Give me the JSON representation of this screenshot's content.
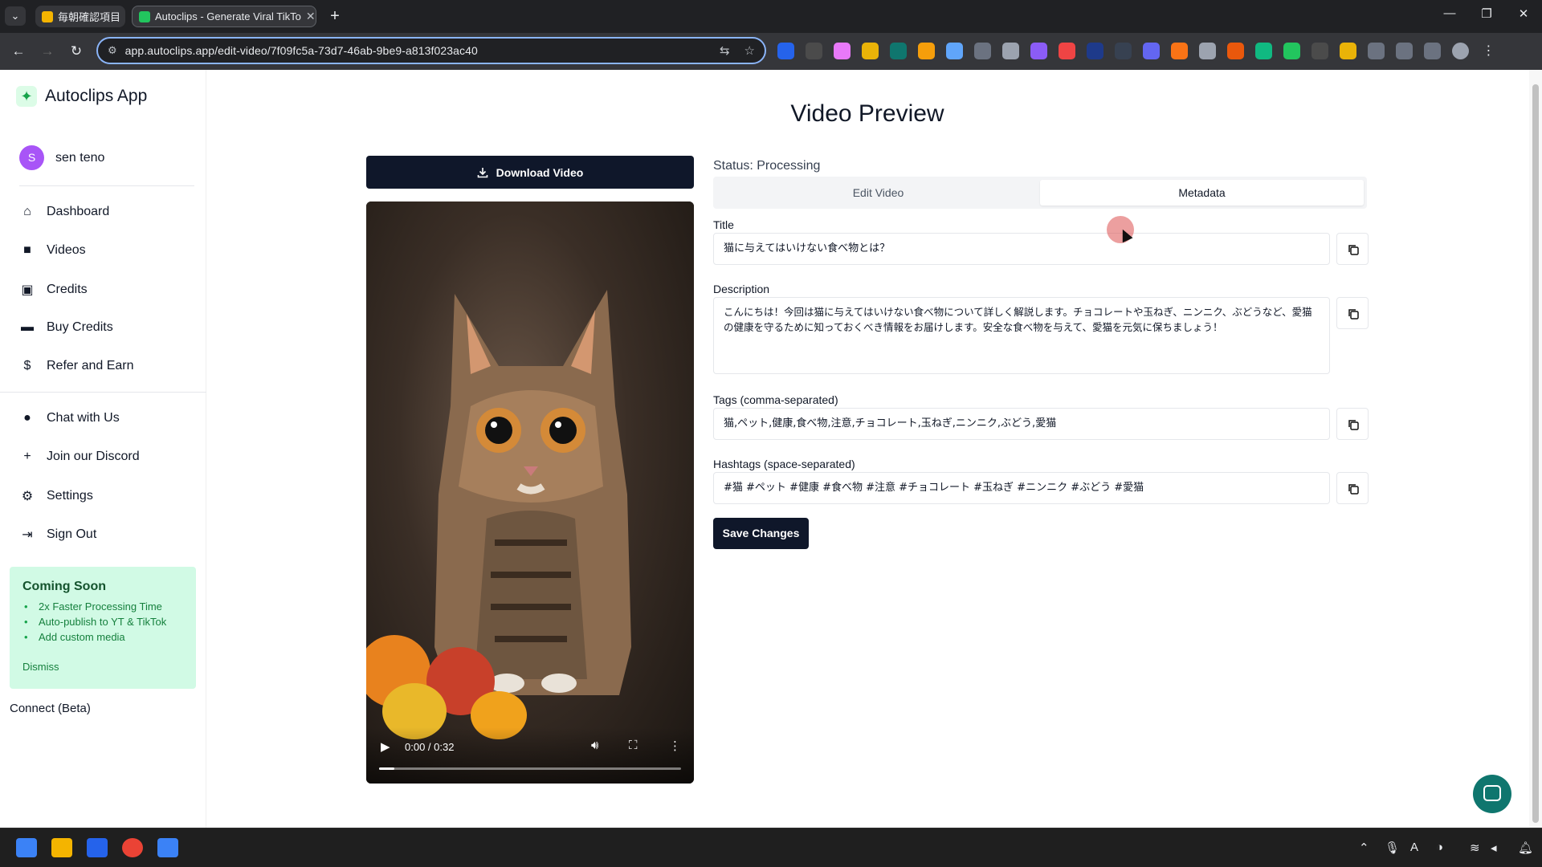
{
  "browser": {
    "tabs": [
      {
        "label": "毎朝確認項目"
      },
      {
        "label": "Autoclips - Generate Viral TikTo"
      }
    ],
    "url": "app.autoclips.app/edit-video/7f09fc5a-73d7-46ab-9be9-a813f023ac40"
  },
  "sidebar": {
    "brand": "Autoclips App",
    "user": {
      "initial": "S",
      "name": "sen teno"
    },
    "nav": [
      {
        "label": "Dashboard",
        "icon": "home-icon"
      },
      {
        "label": "Videos",
        "icon": "video-camera-icon"
      },
      {
        "label": "Credits",
        "icon": "receipt-icon"
      },
      {
        "label": "Buy Credits",
        "icon": "credit-card-icon"
      },
      {
        "label": "Refer and Earn",
        "icon": "dollar-circle-icon"
      }
    ],
    "nav2": [
      {
        "label": "Chat with Us",
        "icon": "chat-bubble-icon"
      },
      {
        "label": "Join our Discord",
        "icon": "plus-icon"
      },
      {
        "label": "Settings",
        "icon": "gear-icon"
      },
      {
        "label": "Sign Out",
        "icon": "sign-out-icon"
      }
    ],
    "coming_soon": {
      "title": "Coming Soon",
      "items": [
        "2x Faster Processing Time",
        "Auto-publish to YT & TikTok",
        "Add custom media"
      ],
      "dismiss": "Dismiss"
    },
    "connect": "Connect (Beta)"
  },
  "main": {
    "title": "Video Preview",
    "download_label": "Download Video",
    "video": {
      "time": "0:00 / 0:32",
      "progress": 0.05
    },
    "status": "Status: Processing",
    "tabs": [
      {
        "label": "Edit Video",
        "active": false
      },
      {
        "label": "Metadata",
        "active": true
      }
    ],
    "fields": {
      "title": {
        "label": "Title",
        "value": "猫に与えてはいけない食べ物とは？"
      },
      "description": {
        "label": "Description",
        "value": "こんにちは！今回は猫に与えてはいけない食べ物について詳しく解説します。チョコレートや玉ねぎ、ニンニク、ぶどうなど、愛猫の健康を守るために知っておくべき情報をお届けします。安全な食べ物を与えて、愛猫を元気に保ちましょう！"
      },
      "tags": {
        "label": "Tags (comma-separated)",
        "value": "猫,ペット,健康,食べ物,注意,チョコレート,玉ねぎ,ニンニク,ぶどう,愛猫"
      },
      "hashtags": {
        "label": "Hashtags (space-separated)",
        "value": "#猫 #ペット #健康 #食べ物 #注意 #チョコレート #玉ねぎ #ニンニク #ぶどう #愛猫"
      }
    },
    "save_label": "Save Changes"
  },
  "colors": {
    "primary_dark": "#0f172a",
    "accent_green": "#d1fae5",
    "avatar": "#a855f7",
    "chat_fab": "#0f766e"
  }
}
